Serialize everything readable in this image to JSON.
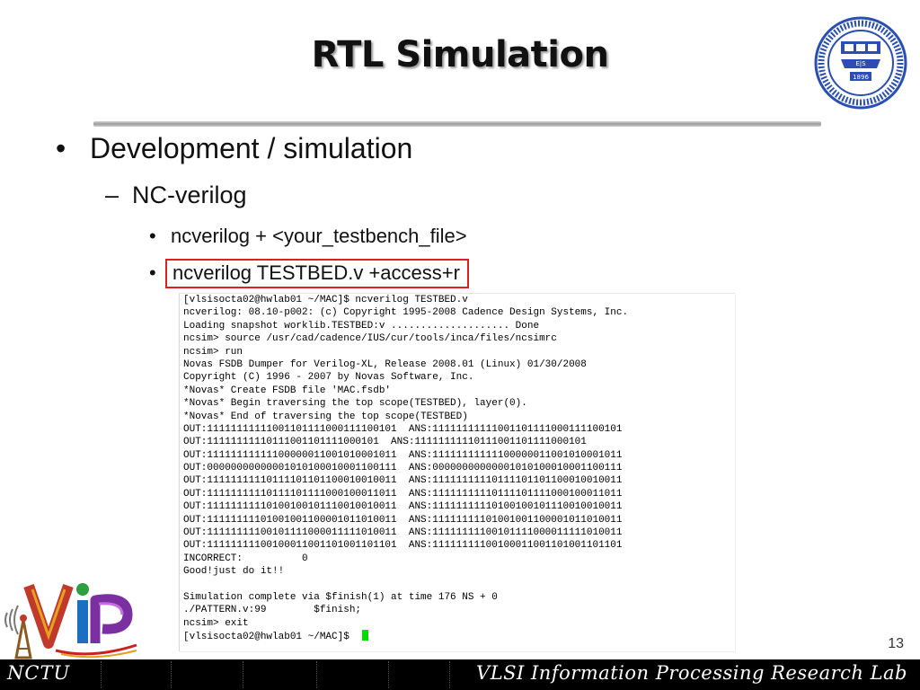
{
  "slide": {
    "title": "RTL Simulation",
    "page_number": "13"
  },
  "bullets": {
    "level1": {
      "mark": "•",
      "text": "Development / simulation"
    },
    "level2": {
      "mark": "–",
      "text": "NC-verilog"
    },
    "level3a": {
      "mark": "•",
      "text": "ncverilog + <your_testbench_file>"
    },
    "level3b": {
      "mark": "•",
      "text": "ncverilog TESTBED.v +access+r"
    }
  },
  "terminal": {
    "lines": [
      "[vlsisocta02@hwlab01 ~/MAC]$ ncverilog TESTBED.v",
      "ncverilog: 08.10-p002: (c) Copyright 1995-2008 Cadence Design Systems, Inc.",
      "Loading snapshot worklib.TESTBED:v .................... Done",
      "ncsim> source /usr/cad/cadence/IUS/cur/tools/inca/files/ncsimrc",
      "ncsim> run",
      "Novas FSDB Dumper for Verilog-XL, Release 2008.01 (Linux) 01/30/2008",
      "Copyright (C) 1996 - 2007 by Novas Software, Inc.",
      "*Novas* Create FSDB file 'MAC.fsdb'",
      "*Novas* Begin traversing the top scope(TESTBED), layer(0).",
      "*Novas* End of traversing the top scope(TESTBED)",
      "OUT:11111111111001101111000111100101  ANS:11111111111001101111000111100101",
      "OUT:11111111110111001101111000101  ANS:11111111110111001101111000101",
      "OUT:11111111111100000011001010001011  ANS:11111111111100000011001010001011",
      "OUT:00000000000001010100010001100111  ANS:00000000000001010100010001100111",
      "OUT:11111111110111101101100010010011  ANS:11111111110111101101100010010011",
      "OUT:11111111110111101111000100011011  ANS:11111111110111101111000100011011",
      "OUT:11111111110100100101110010010011  ANS:11111111110100100101110010010011",
      "OUT:11111111101001001100001011010011  ANS:11111111101001001100001011010011",
      "OUT:11111111100101111000011111010011  ANS:11111111100101111000011111010011",
      "OUT:11111111100100011001101001101101  ANS:11111111100100011001101001101101",
      "INCORRECT:          0",
      "Good!just do it!!",
      "",
      "Simulation complete via $finish(1) at time 176 NS + 0",
      "./PATTERN.v:99        $finish;",
      "ncsim> exit",
      "[vlsisocta02@hwlab01 ~/MAC]$ "
    ],
    "cursor_color": "#00dd00"
  },
  "university_logo": {
    "icon": "nctu-seal-icon",
    "year": "1896",
    "letters": "E|S"
  },
  "lab_logo": {
    "icon": "vip-lab-logo-icon",
    "text": "VIP"
  },
  "footer": {
    "left": "NCTU",
    "right": "VLSI Information Processing Research Lab"
  },
  "colors": {
    "highlight_box": "#e02020",
    "seal_blue": "#2a4fb0",
    "footer_bg": "#000000"
  }
}
